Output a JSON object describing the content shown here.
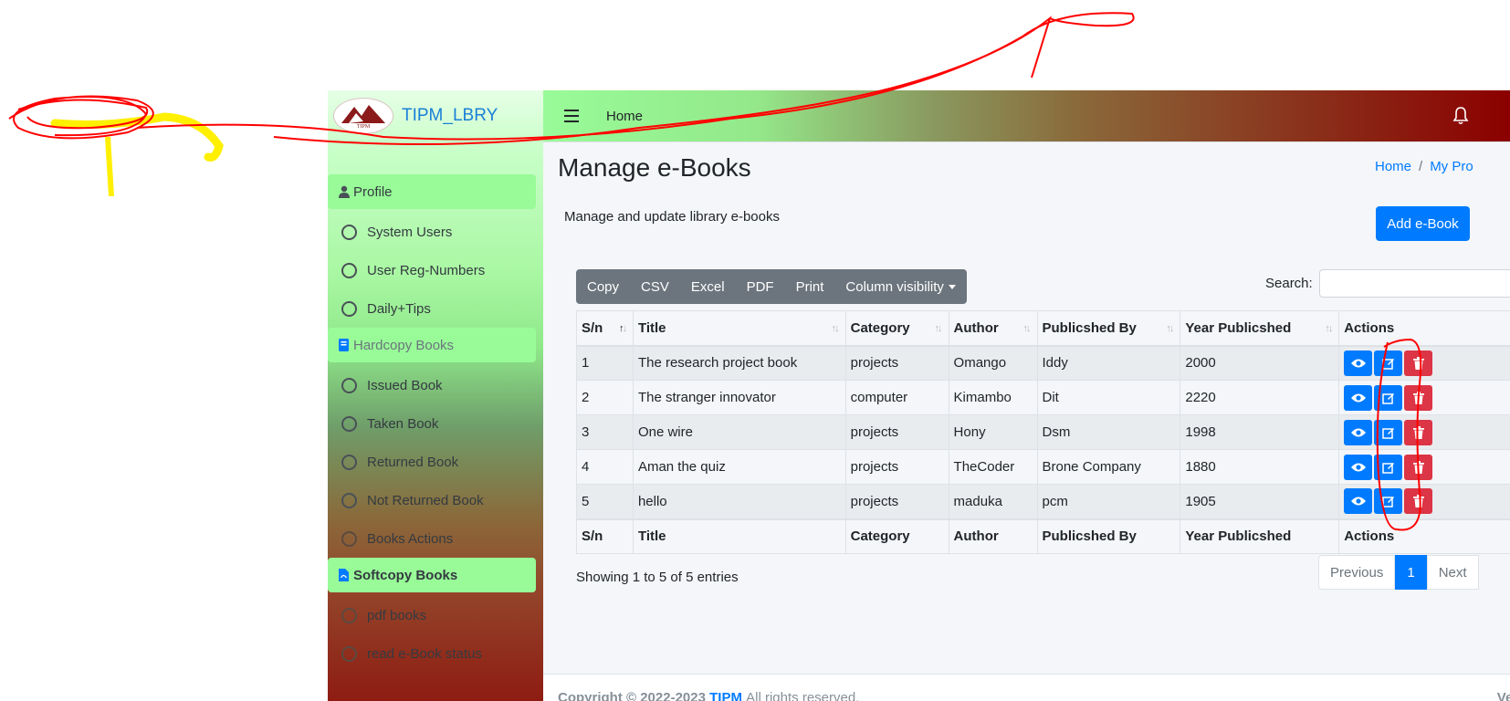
{
  "colors": {
    "accent": "#007bff",
    "danger": "#dc3545",
    "secondary": "#6c757d",
    "sidebar_active": "#98fb98"
  },
  "brand": {
    "name": "TIPM_LBRY",
    "logo_text": "TIPM"
  },
  "topbar": {
    "home_link": "Home"
  },
  "sidebar": {
    "profile": "Profile",
    "profile_items": [
      "System Users",
      "User Reg-Numbers",
      "Daily+Tips"
    ],
    "hardcopy": "Hardcopy Books",
    "hardcopy_items": [
      "Issued Book",
      "Taken Book",
      "Returned Book",
      "Not Returned Book",
      "Books Actions"
    ],
    "softcopy": "Softcopy Books",
    "softcopy_items": [
      "pdf books",
      "read e-Book status"
    ]
  },
  "page": {
    "title": "Manage e-Books",
    "subtitle": "Manage and update library e-books",
    "add_button": "Add e-Book",
    "breadcrumb": [
      "Home",
      "My Pro"
    ]
  },
  "toolbar": {
    "buttons": [
      "Copy",
      "CSV",
      "Excel",
      "PDF",
      "Print",
      "Column visibility"
    ],
    "search_label": "Search:"
  },
  "table": {
    "columns": [
      "S/n",
      "Title",
      "Category",
      "Author",
      "Publicshed By",
      "Year Publicshed",
      "Actions"
    ],
    "rows": [
      [
        "1",
        "The research project book",
        "projects",
        "Omango",
        "Iddy",
        "2000"
      ],
      [
        "2",
        "The stranger innovator",
        "computer",
        "Kimambo",
        "Dit",
        "2220"
      ],
      [
        "3",
        "One wire",
        "projects",
        "Hony",
        "Dsm",
        "1998"
      ],
      [
        "4",
        "Aman the quiz",
        "projects",
        "TheCoder",
        "Brone Company",
        "1880"
      ],
      [
        "5",
        "hello",
        "projects",
        "maduka",
        "pcm",
        "1905"
      ]
    ]
  },
  "pagination": {
    "info": "Showing 1 to 5 of 5 entries",
    "previous": "Previous",
    "current": "1",
    "next": "Next"
  },
  "footer": {
    "copyright": "Copyright © 2022-2023",
    "org": "TIPM",
    "rights": "All rights reserved.",
    "version": "Version"
  }
}
